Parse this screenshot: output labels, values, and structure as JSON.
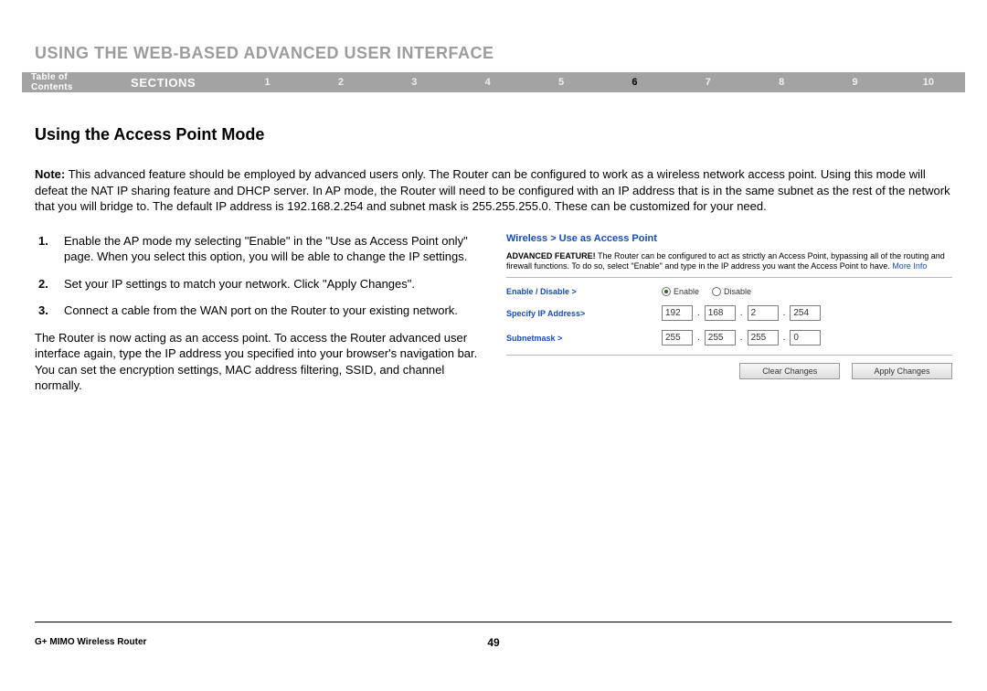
{
  "chapter_title": "USING THE WEB-BASED ADVANCED USER INTERFACE",
  "nav": {
    "toc": "Table of Contents",
    "sections_label": "SECTIONS",
    "numbers": [
      "1",
      "2",
      "3",
      "4",
      "5",
      "6",
      "7",
      "8",
      "9",
      "10"
    ],
    "active_index": 5
  },
  "section_title": "Using the Access Point Mode",
  "note_label": "Note:",
  "note_body": " This advanced feature should be employed by advanced users only. The Router can be configured to work as a wireless network access point. Using this mode will defeat the NAT IP sharing feature and DHCP server. In AP mode, the Router will need to be configured with an IP address that is in the same subnet as the rest of the network that you will bridge to. The default IP address is 192.168.2.254 and subnet mask is 255.255.255.0. These can be customized for your need.",
  "steps": [
    "Enable the AP mode my selecting \"Enable\" in the \"Use as Access Point only\" page. When you select this option, you will be able to change the IP settings.",
    "Set your IP settings to match your network. Click \"Apply Changes\".",
    "Connect a cable from the WAN port on the Router to your existing network."
  ],
  "closing": "The Router is now acting as an access point. To access the Router advanced user interface again, type the IP address you specified into your browser's navigation bar. You can set the encryption settings, MAC address filtering, SSID, and channel normally.",
  "router_panel": {
    "breadcrumb": "Wireless > Use as Access Point",
    "adv_label": "ADVANCED FEATURE!",
    "adv_body": " The Router can be configured to act as strictly an Access Point, bypassing all of the routing and firewall functions. To do so, select \"Enable\" and type in the IP address you want the Access Point to have. ",
    "more_info": "More Info",
    "enable_label": "Enable / Disable >",
    "enable_option": "Enable",
    "disable_option": "Disable",
    "ip_label": "Specify IP Address>",
    "ip": [
      "192",
      "168",
      "2",
      "254"
    ],
    "mask_label": "Subnetmask >",
    "mask": [
      "255",
      "255",
      "255",
      "0"
    ],
    "btn_clear": "Clear Changes",
    "btn_apply": "Apply Changes"
  },
  "footer": {
    "product": "G+ MIMO Wireless Router",
    "page": "49"
  }
}
